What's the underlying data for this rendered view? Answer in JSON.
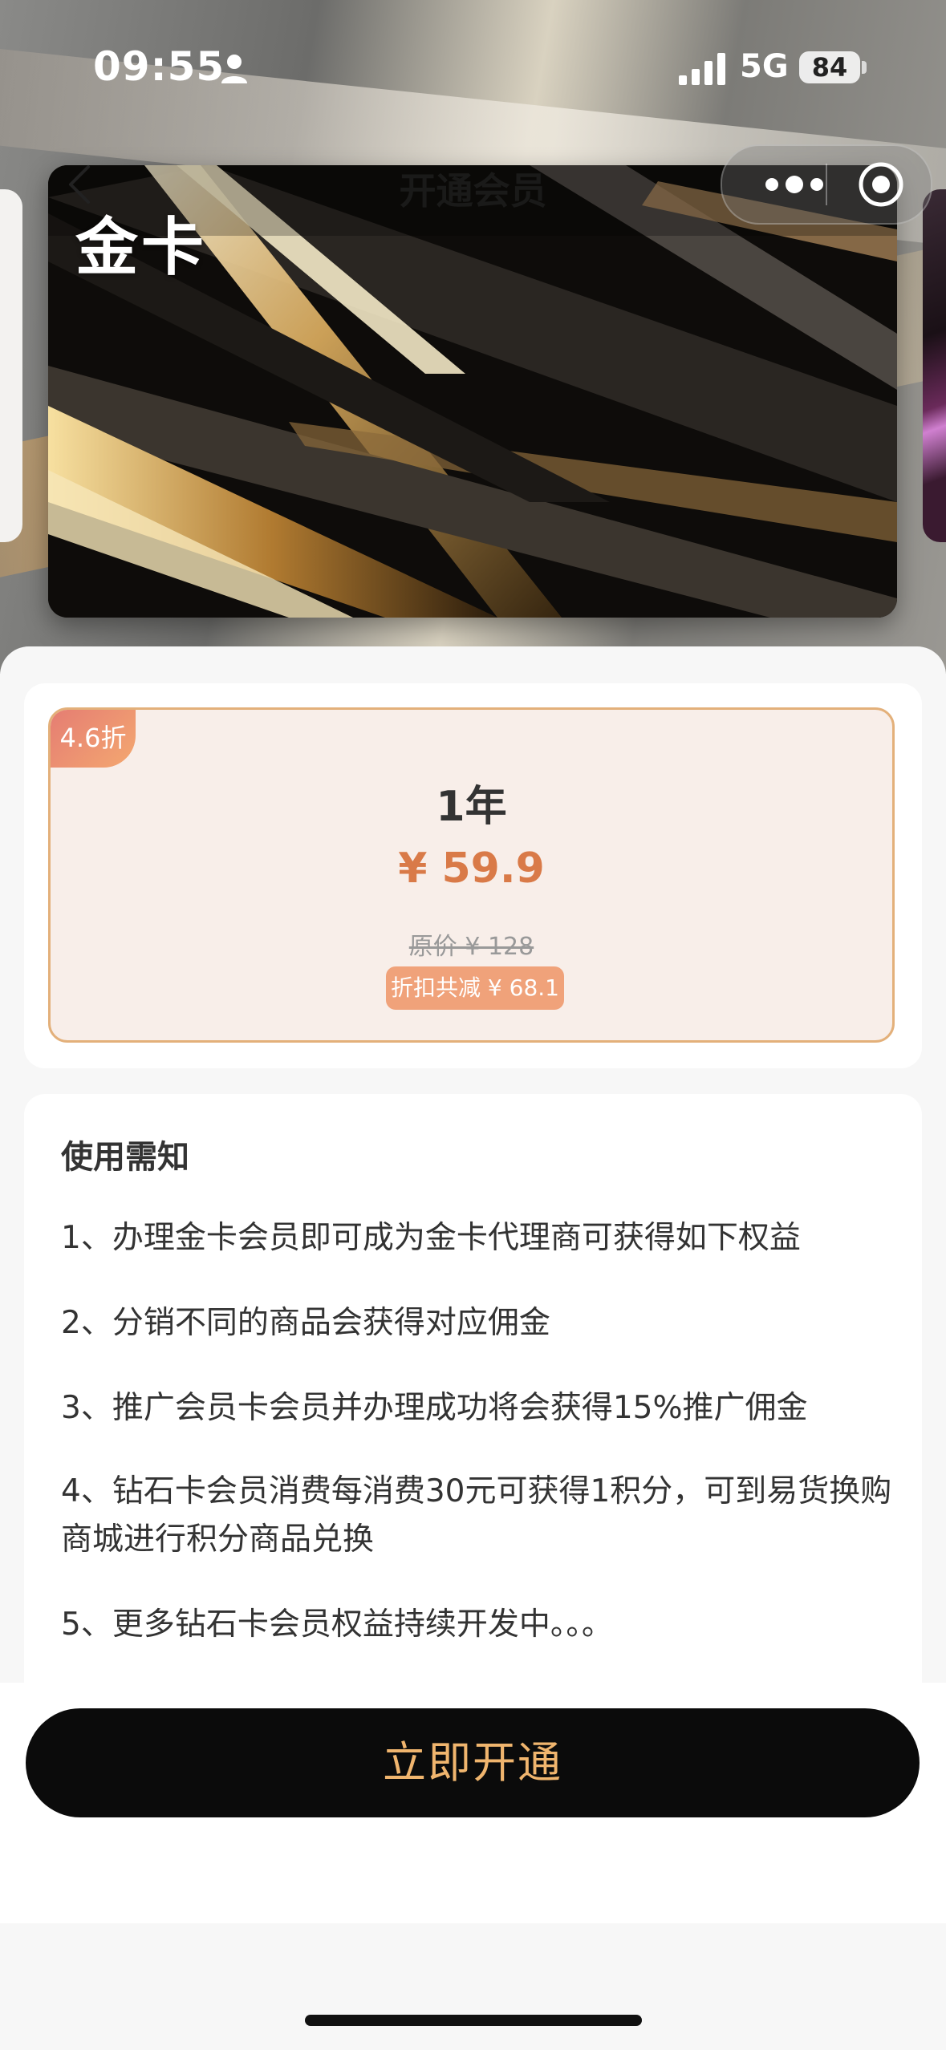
{
  "status_bar": {
    "time": "09:55",
    "network": "5G",
    "battery": "84"
  },
  "nav": {
    "title": "开通会员"
  },
  "card": {
    "title": "金卡"
  },
  "plan": {
    "discount_badge": "4.6折",
    "name": "1年",
    "price": "¥ 59.9",
    "original_price": "原价 ¥ 128",
    "saving": "折扣共减 ¥ 68.1"
  },
  "notice": {
    "title": "使用需知",
    "items": [
      "1、办理金卡会员即可成为金卡代理商可获得如下权益",
      "2、分销不同的商品会获得对应佣金",
      "3、推广会员卡会员并办理成功将会获得15%推广佣金",
      "4、钻石卡会员消费每消费30元可获得1积分，可到易货换购商城进行积分商品兑换",
      "5、更多钻石卡会员权益持续开发中。。。"
    ]
  },
  "cta": {
    "label": "立即开通"
  },
  "colors": {
    "accent_gold": "#f0b56e",
    "price_orange": "#d97a48",
    "card_border": "#e3b07a"
  }
}
